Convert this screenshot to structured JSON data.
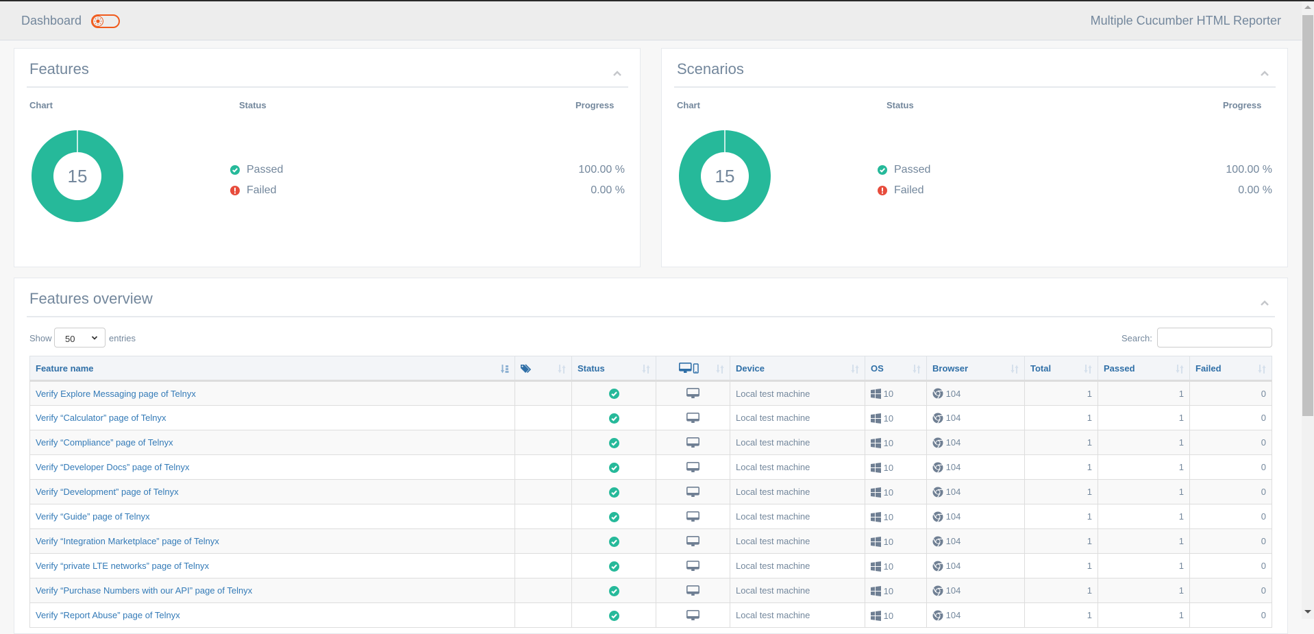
{
  "navbar": {
    "title": "Dashboard",
    "theme_toggle_icon": "sun-icon",
    "brand": "Multiple Cucumber HTML Reporter"
  },
  "colors": {
    "passed": "#26b99a",
    "failed": "#e74c3c",
    "link": "#337ab7",
    "text": "#73879c",
    "toggle": "#f05a1c"
  },
  "features_panel": {
    "title": "Features",
    "col_chart": "Chart",
    "col_status": "Status",
    "col_progress": "Progress",
    "total": "15",
    "statuses": [
      {
        "label": "Passed",
        "icon": "check-circle-icon",
        "progress": "100.00 %"
      },
      {
        "label": "Failed",
        "icon": "exclamation-circle-icon",
        "progress": "0.00 %"
      }
    ]
  },
  "scenarios_panel": {
    "title": "Scenarios",
    "col_chart": "Chart",
    "col_status": "Status",
    "col_progress": "Progress",
    "total": "15",
    "statuses": [
      {
        "label": "Passed",
        "icon": "check-circle-icon",
        "progress": "100.00 %"
      },
      {
        "label": "Failed",
        "icon": "exclamation-circle-icon",
        "progress": "0.00 %"
      }
    ]
  },
  "chart_data": [
    {
      "type": "pie",
      "title": "Features",
      "center_label": "15",
      "categories": [
        "Passed",
        "Failed"
      ],
      "values": [
        15,
        0
      ]
    },
    {
      "type": "pie",
      "title": "Scenarios",
      "center_label": "15",
      "categories": [
        "Passed",
        "Failed"
      ],
      "values": [
        15,
        0
      ]
    }
  ],
  "overview": {
    "title": "Features overview",
    "show_label": "Show",
    "entries_value": "50",
    "entries_label": "entries",
    "search_label": "Search:",
    "search_value": "",
    "columns": [
      "Feature name",
      "",
      "Status",
      "",
      "Device",
      "OS",
      "Browser",
      "Total",
      "Passed",
      "Failed"
    ],
    "column_icons": {
      "tags": "tag-icon",
      "device_type": "desktop-mobile-icon"
    },
    "rows": [
      {
        "name": "Verify Explore Messaging page of Telnyx",
        "tags": "",
        "status": "passed",
        "device_icon": "desktop-icon",
        "device": "Local test machine",
        "os": "10",
        "browser": "104",
        "total": "1",
        "passed": "1",
        "failed": "0"
      },
      {
        "name": "Verify “Calculator” page of Telnyx",
        "tags": "",
        "status": "passed",
        "device_icon": "desktop-icon",
        "device": "Local test machine",
        "os": "10",
        "browser": "104",
        "total": "1",
        "passed": "1",
        "failed": "0"
      },
      {
        "name": "Verify “Compliance” page of Telnyx",
        "tags": "",
        "status": "passed",
        "device_icon": "desktop-icon",
        "device": "Local test machine",
        "os": "10",
        "browser": "104",
        "total": "1",
        "passed": "1",
        "failed": "0"
      },
      {
        "name": "Verify “Developer Docs” page of Telnyx",
        "tags": "",
        "status": "passed",
        "device_icon": "desktop-icon",
        "device": "Local test machine",
        "os": "10",
        "browser": "104",
        "total": "1",
        "passed": "1",
        "failed": "0"
      },
      {
        "name": "Verify “Development” page of Telnyx",
        "tags": "",
        "status": "passed",
        "device_icon": "desktop-icon",
        "device": "Local test machine",
        "os": "10",
        "browser": "104",
        "total": "1",
        "passed": "1",
        "failed": "0"
      },
      {
        "name": "Verify “Guide” page of Telnyx",
        "tags": "",
        "status": "passed",
        "device_icon": "desktop-icon",
        "device": "Local test machine",
        "os": "10",
        "browser": "104",
        "total": "1",
        "passed": "1",
        "failed": "0"
      },
      {
        "name": "Verify “Integration Marketplace” page of Telnyx",
        "tags": "",
        "status": "passed",
        "device_icon": "desktop-icon",
        "device": "Local test machine",
        "os": "10",
        "browser": "104",
        "total": "1",
        "passed": "1",
        "failed": "0"
      },
      {
        "name": "Verify “private LTE networks” page of Telnyx",
        "tags": "",
        "status": "passed",
        "device_icon": "desktop-icon",
        "device": "Local test machine",
        "os": "10",
        "browser": "104",
        "total": "1",
        "passed": "1",
        "failed": "0"
      },
      {
        "name": "Verify “Purchase Numbers with our API” page of Telnyx",
        "tags": "",
        "status": "passed",
        "device_icon": "desktop-icon",
        "device": "Local test machine",
        "os": "10",
        "browser": "104",
        "total": "1",
        "passed": "1",
        "failed": "0"
      },
      {
        "name": "Verify “Report Abuse” page of Telnyx",
        "tags": "",
        "status": "passed",
        "device_icon": "desktop-icon",
        "device": "Local test machine",
        "os": "10",
        "browser": "104",
        "total": "1",
        "passed": "1",
        "failed": "0"
      }
    ]
  }
}
